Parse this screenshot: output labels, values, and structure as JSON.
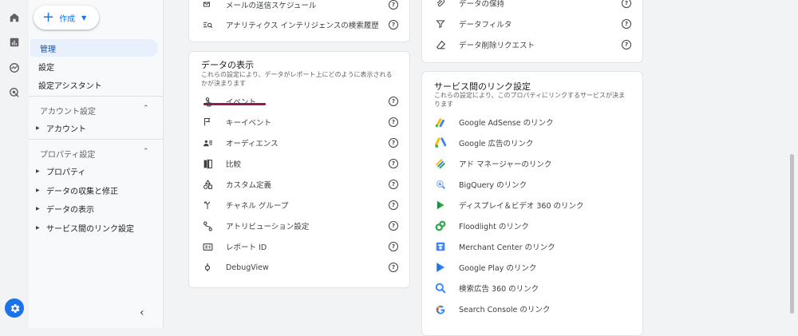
{
  "create_button": {
    "label": "作成"
  },
  "rail": {
    "icons": [
      "home-icon",
      "bar-chart-icon",
      "explore-icon",
      "ads-icon",
      "settings-gear-icon"
    ]
  },
  "sidebar": {
    "items": [
      {
        "label": "管理",
        "active": true
      },
      {
        "label": "設定"
      },
      {
        "label": "設定アシスタント"
      }
    ],
    "account_section": {
      "heading": "アカウント設定",
      "items": [
        "アカウント"
      ]
    },
    "property_section": {
      "heading": "プロパティ設定",
      "items": [
        "プロパティ",
        "データの収集と修正",
        "データの表示",
        "サービス間のリンク設定"
      ]
    }
  },
  "card_top_left": {
    "rows": [
      {
        "label": "メールの送信スケジュール",
        "icon": "schedule-email-icon"
      },
      {
        "label": "アナリティクス インテリジェンスの検索履歴",
        "icon": "search-history-icon"
      }
    ]
  },
  "card_top_right": {
    "rows": [
      {
        "label": "データの保持",
        "icon": "retention-icon"
      },
      {
        "label": "データフィルタ",
        "icon": "filter-icon"
      },
      {
        "label": "データ削除リクエスト",
        "icon": "eraser-icon"
      }
    ]
  },
  "data_display_card": {
    "title": "データの表示",
    "description_line1": "これらの設定により、データがレポート上にどのように表示される",
    "description_line2": "かが決まります",
    "rows": [
      {
        "label": "イベント",
        "icon": "touch-icon"
      },
      {
        "label": "キーイベント",
        "icon": "flag-icon"
      },
      {
        "label": "オーディエンス",
        "icon": "audience-icon"
      },
      {
        "label": "比較",
        "icon": "compare-icon"
      },
      {
        "label": "カスタム定義",
        "icon": "shapes-icon"
      },
      {
        "label": "チャネル グループ",
        "icon": "merge-icon"
      },
      {
        "label": "アトリビューション設定",
        "icon": "attribution-icon"
      },
      {
        "label": "レポート ID",
        "icon": "id-icon"
      },
      {
        "label": "DebugView",
        "icon": "debug-icon"
      }
    ]
  },
  "link_card": {
    "title": "サービス間のリンク設定",
    "description_line1": "これらの設定により、このプロパティにリンクするサービスが決ま",
    "description_line2": "ります",
    "rows": [
      {
        "label": "Google AdSense のリンク",
        "icon": "adsense-icon"
      },
      {
        "label": "Google 広告のリンク",
        "icon": "google-ads-icon"
      },
      {
        "label": "アド マネージャーのリンク",
        "icon": "ad-manager-icon"
      },
      {
        "label": "BigQuery のリンク",
        "icon": "bigquery-icon"
      },
      {
        "label": "ディスプレイ＆ビデオ 360 のリンク",
        "icon": "dv360-icon"
      },
      {
        "label": "Floodlight のリンク",
        "icon": "floodlight-icon"
      },
      {
        "label": "Merchant Center のリンク",
        "icon": "merchant-center-icon"
      },
      {
        "label": "Google Play のリンク",
        "icon": "google-play-icon"
      },
      {
        "label": "検索広告 360 のリンク",
        "icon": "search-ads-360-icon"
      },
      {
        "label": "Search Console のリンク",
        "icon": "search-console-icon"
      }
    ]
  },
  "help_glyph": "?",
  "colors": {
    "accent": "#1a73e8",
    "active_bg": "#e8f0fe",
    "highlight_underline": "#a0135a"
  }
}
